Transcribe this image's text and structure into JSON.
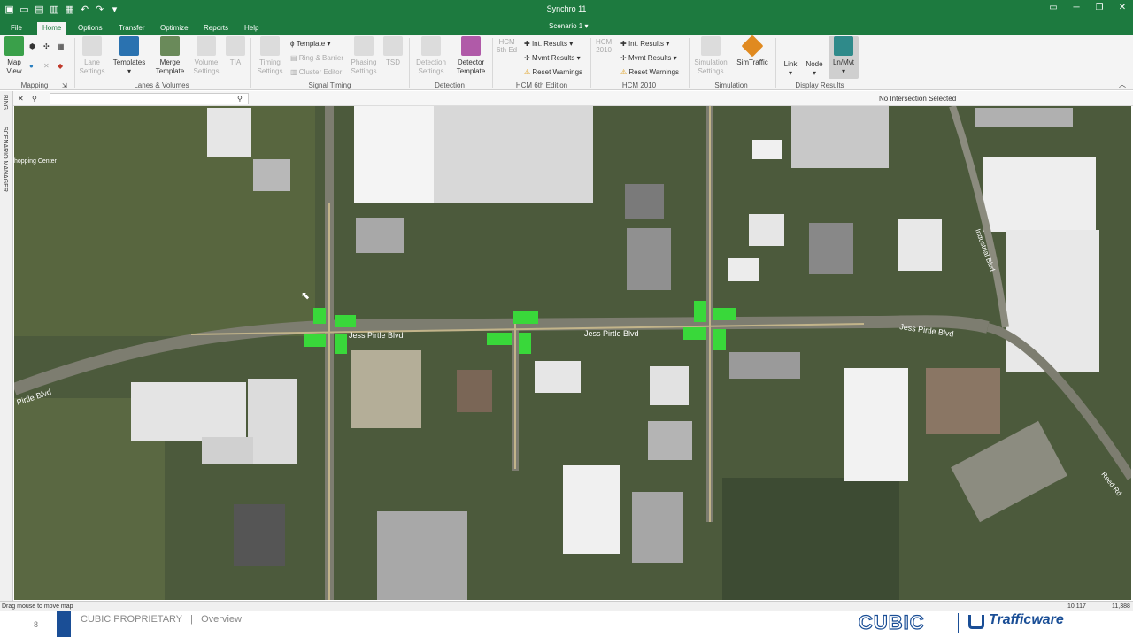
{
  "title_bar": {
    "app_title": "Synchro 11",
    "scenario": "Scenario 1"
  },
  "menu_tabs": [
    "File",
    "Home",
    "Options",
    "Transfer",
    "Optimize",
    "Reports",
    "Help"
  ],
  "active_tab": "Home",
  "ribbon": {
    "mapping": {
      "label": "Mapping",
      "map_view": "Map\nView"
    },
    "lanes_volumes": {
      "label": "Lanes & Volumes",
      "lane_settings": "Lane\nSettings",
      "templates": "Templates",
      "merge_template": "Merge\nTemplate",
      "volume_settings": "Volume\nSettings",
      "tia": "TIA"
    },
    "signal_timing": {
      "label": "Signal Timing",
      "timing_settings": "Timing\nSettings",
      "template": "Template",
      "ring_barrier": "Ring & Barrier",
      "cluster_editor": "Cluster Editor",
      "phasing_settings": "Phasing\nSettings",
      "tsd": "TSD"
    },
    "detection": {
      "label": "Detection",
      "detection_settings": "Detection\nSettings",
      "detector_template": "Detector\nTemplate"
    },
    "hcm6": {
      "label": "HCM 6th Edition",
      "int_results": "Int. Results",
      "mvmt_results": "Mvmt Results",
      "reset_warnings": "Reset Warnings",
      "hcm_icon_label": "HCM\n6th Ed"
    },
    "hcm2010": {
      "label": "HCM 2010",
      "int_results": "Int. Results",
      "mvmt_results": "Mvmt Results",
      "reset_warnings": "Reset Warnings",
      "hcm_icon_label": "HCM\n2010"
    },
    "simulation": {
      "label": "Simulation",
      "simulation_settings": "Simulation\nSettings",
      "simtraffic": "SimTraffic"
    },
    "display_results": {
      "label": "Display Results",
      "link": "Link",
      "node": "Node",
      "ln_mvt": "Ln/Mvt"
    }
  },
  "status_strip": {
    "no_intersection": "No Intersection Selected",
    "search_value": ""
  },
  "sidebar": {
    "bing": "BING",
    "scenario_manager": "SCENARIO MANAGER"
  },
  "map": {
    "labels": {
      "jess_pirtle_1": "Jess Pirtle Blvd",
      "jess_pirtle_2": "Jess Pirtle Blvd",
      "jess_pirtle_3": "Jess Pirtle Blvd",
      "pirtle_blvd_left": "Pirtle Blvd",
      "industrial_blvd": "Industrial Blvd",
      "reed_rd": "Reed Rd",
      "shopping_center": "hopping Center"
    },
    "intersection_color": "#39d83a",
    "road_color": "#8a8a78"
  },
  "status_bar": {
    "hint": "Drag mouse to move map",
    "coord_x": "10,117",
    "coord_y": "11,388"
  },
  "footer": {
    "page_number": "8",
    "text": "CUBIC PROPRIETARY   |   Overview",
    "logo_cubic": "CUBIC",
    "logo_trafficware": "Trafficware",
    "brand_color": "#1a4e96"
  },
  "colors": {
    "title_green": "#1d7a3f",
    "ribbon_bg": "#f4f4f4"
  }
}
